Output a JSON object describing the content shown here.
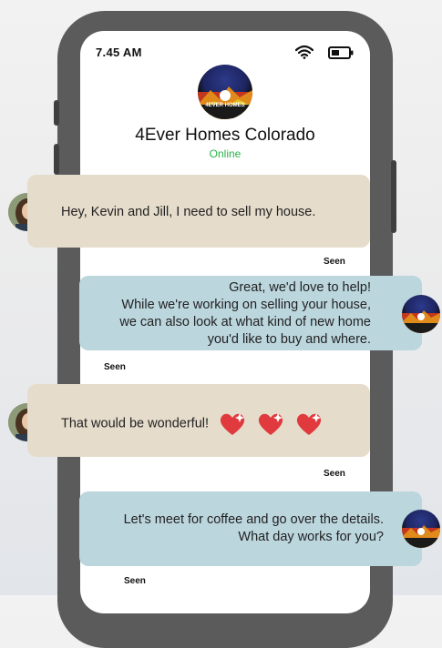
{
  "status_bar": {
    "time": "7.45 AM"
  },
  "header": {
    "avatar_text": "4EVER HOMES",
    "contact_name": "4Ever Homes Colorado",
    "status": "Online"
  },
  "messages": [
    {
      "direction": "incoming",
      "text": "Hey, Kevin and Jill, I need to sell my house.",
      "receipt": "Seen"
    },
    {
      "direction": "outgoing",
      "lines": [
        "Great, we'd love to help!",
        "While we're working on  selling your house,",
        "we can also look at what kind of new home",
        "you'd like to buy and where."
      ],
      "receipt": "Seen"
    },
    {
      "direction": "incoming",
      "text": "That would be wonderful!",
      "emoji": "sparkling-heart x3",
      "receipt": "Seen"
    },
    {
      "direction": "outgoing",
      "lines": [
        "Let's meet for coffee and go over the details.",
        "What day works for you?"
      ],
      "receipt": "Seen"
    }
  ],
  "colors": {
    "incoming_bubble": "#e5dccb",
    "outgoing_bubble": "#bcd6de",
    "online_green": "#28b34a",
    "phone_frame": "#5b5b5b"
  }
}
